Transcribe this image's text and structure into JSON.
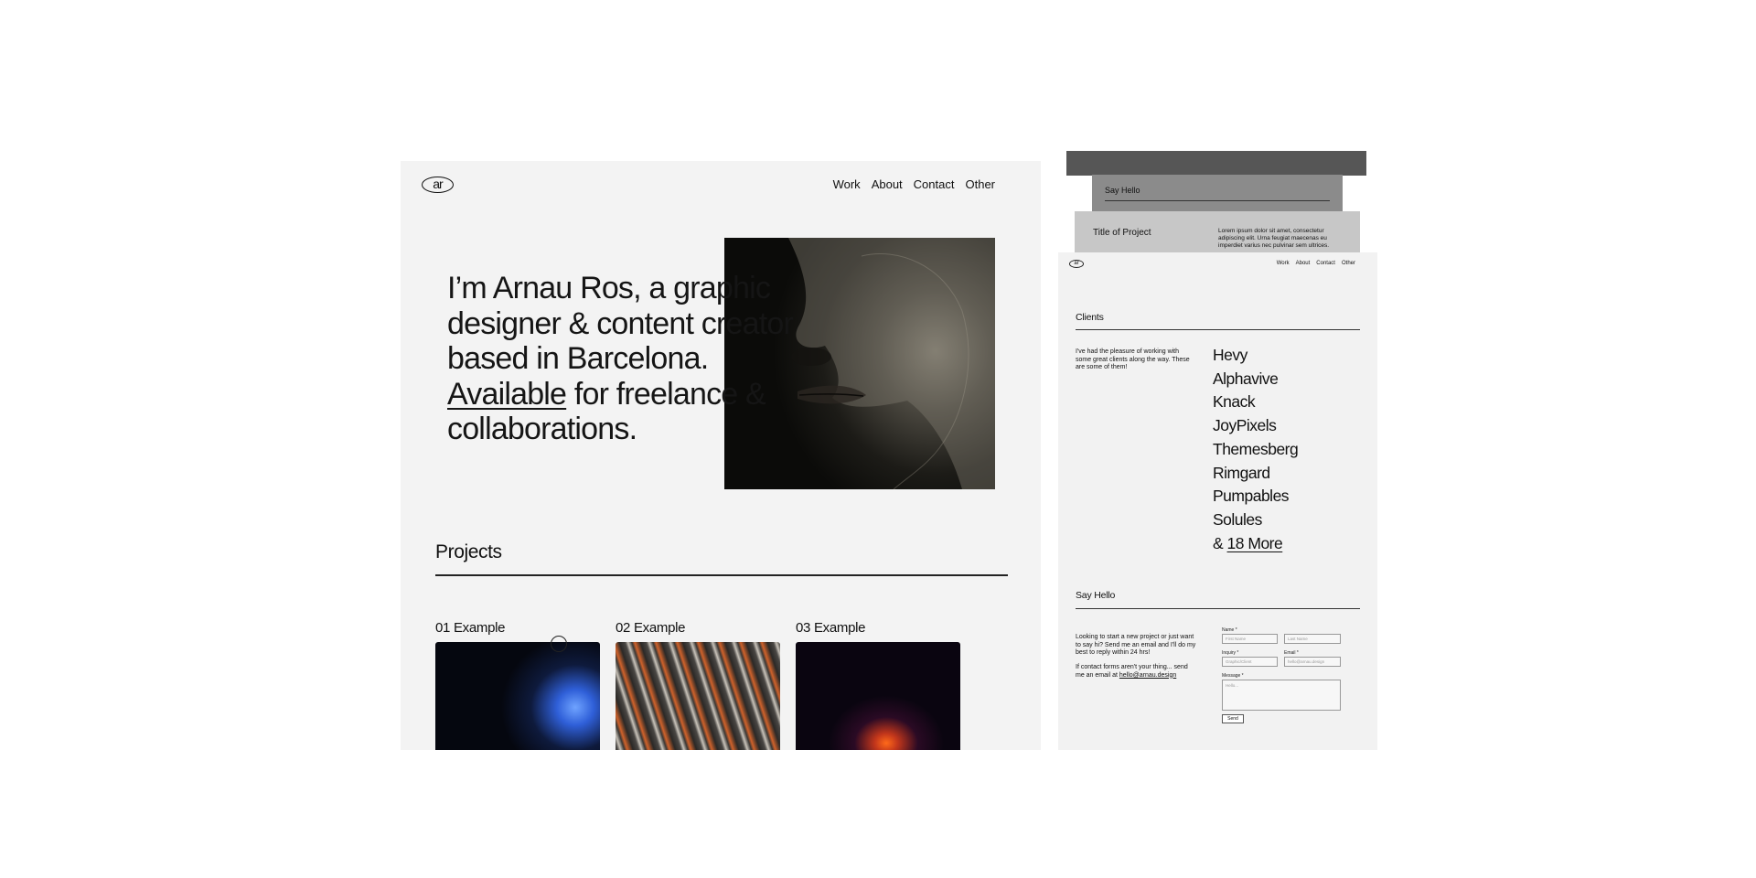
{
  "main": {
    "logo": "ar",
    "nav": [
      "Work",
      "About",
      "Contact",
      "Other"
    ],
    "hero": {
      "line1": "I’m Arnau Ros, a graphic",
      "line2": "designer & content creator",
      "line3": "based in Barcelona.",
      "available": "Available",
      "line4_rest": " for freelance &",
      "line5": "collaborations."
    },
    "projects_title": "Projects",
    "projects": [
      {
        "label": "01 Example",
        "colors": [
          "#05070f",
          "#2f5fd8",
          "#6fa3ff"
        ]
      },
      {
        "label": "02 Example",
        "colors": [
          "#2b2927",
          "#c9c3ba",
          "#d0622b"
        ]
      },
      {
        "label": "03 Example",
        "colors": [
          "#0a0510",
          "#c2361b",
          "#ff6a1a"
        ]
      }
    ]
  },
  "cards": {
    "say_hello": "Say Hello",
    "title_of_project": "Title of Project",
    "lorem": "Lorem ipsum dolor sit amet, consectetur adipiscing elit. Urna feugiat maecenas eu imperdiet varius nec pulvinar sem ultrices."
  },
  "side": {
    "logo": "ar",
    "nav": [
      "Work",
      "About",
      "Contact",
      "Other"
    ],
    "clients_heading": "Clients",
    "clients_intro": "I've had the pleasure of working with some great clients along the way. These are some of them!",
    "clients": [
      "Hevy",
      "Alphavive",
      "Knack",
      "JoyPixels",
      "Themesberg",
      "Rimgard",
      "Pumpables",
      "Solules"
    ],
    "more_prefix": "& ",
    "more_link": "18 More",
    "say_hello_heading": "Say Hello",
    "say_hello_text": "Looking to start a new project or just want to say hi? Send me an email and I'll do my best to reply within 24 hrs!",
    "contact_text": "If contact forms aren't your thing... send me an email at ",
    "email": "hello@arnau.design",
    "form": {
      "name_label": "Name *",
      "first_placeholder": "First Name",
      "last_placeholder": "Last Name",
      "inquiry_label": "Inquiry *",
      "inquiry_value": "Graphic/Client",
      "email_label": "Email *",
      "email_placeholder": "hello@arnau.design",
      "message_label": "Message *",
      "message_placeholder": "Hello...",
      "send_label": "Send"
    }
  }
}
